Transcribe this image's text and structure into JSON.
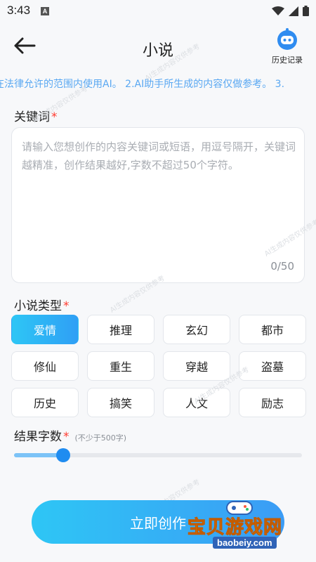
{
  "status_bar": {
    "time": "3:43",
    "notif_icon_letter": "A"
  },
  "header": {
    "title": "小说",
    "history_label": "历史记录"
  },
  "notice": {
    "text": "在法律允许的范围内使用AI。 2.AI助手所生成的内容仅做参考。 3."
  },
  "keyword": {
    "label": "关键词",
    "required_mark": "*",
    "placeholder": "请输入您想创作的内容关键词或短语，用逗号隔开，关键词越精准，创作结果越好,字数不超过50个字符。",
    "value": "",
    "counter": "0/50"
  },
  "genre": {
    "label": "小说类型",
    "required_mark": "*",
    "options": [
      "爱情",
      "推理",
      "玄幻",
      "都市",
      "修仙",
      "重生",
      "穿越",
      "盗墓",
      "历史",
      "搞笑",
      "人文",
      "励志"
    ],
    "selected": "爱情"
  },
  "word_count": {
    "label": "结果字数",
    "required_mark": "*",
    "note": "(不少于500字)",
    "slider_fraction": 0.17
  },
  "actions": {
    "create_label": "立即创作"
  },
  "watermark": {
    "text": "AI生成内容仅供参考"
  },
  "logo": {
    "title": "宝贝游戏网",
    "url": "baobeiy.com"
  },
  "colors": {
    "accent": "#2f9ff5",
    "accent_light": "#2ec6f5",
    "required": "#ff3b30",
    "notice": "#5aa8f2"
  }
}
